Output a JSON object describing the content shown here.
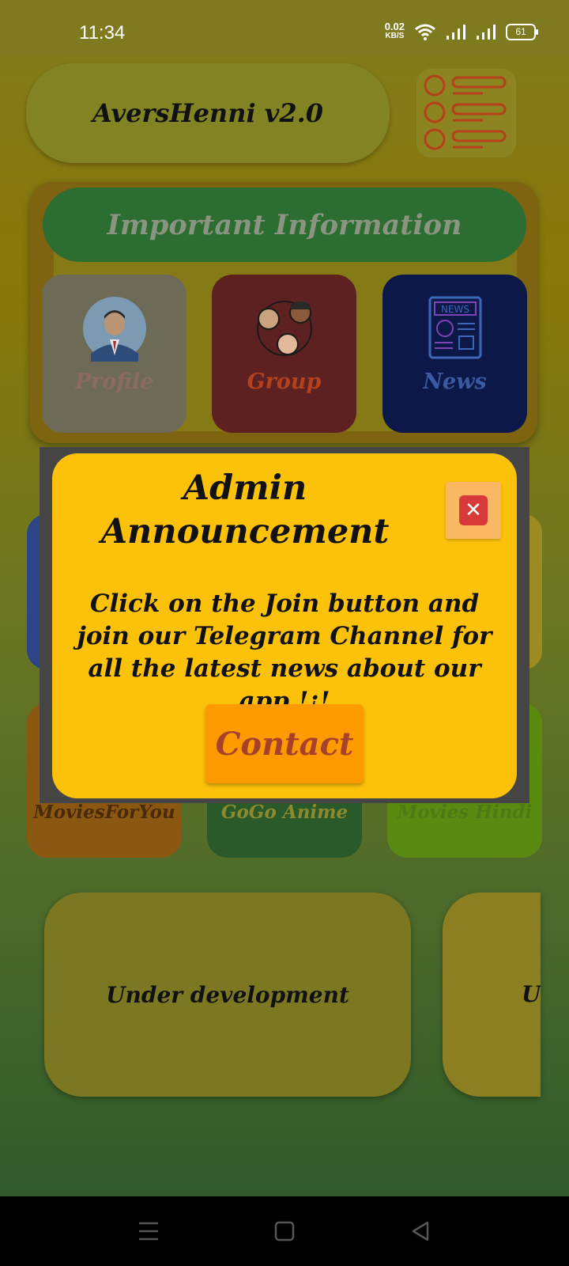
{
  "status_bar": {
    "time": "11:34",
    "net_speed_value": "0.02",
    "net_speed_unit": "KB/S",
    "battery": "61",
    "icons": [
      "wifi-icon",
      "signal-icon",
      "signal-icon",
      "battery-icon"
    ]
  },
  "header": {
    "title": "AversHenni v2.0",
    "menu_icon": "list-icon"
  },
  "info_panel": {
    "title": "Important Information",
    "tiles": [
      {
        "label": "Profile",
        "icon": "profile-avatar-icon",
        "color": "#6e6a58",
        "label_color": "#8c6b66"
      },
      {
        "label": "Group",
        "icon": "group-people-icon",
        "color": "#5c2120",
        "label_color": "#b2421e"
      },
      {
        "label": "News",
        "icon": "newspaper-icon",
        "color": "#0c1848",
        "label_color": "#3b5aa4"
      }
    ]
  },
  "cards": [
    {
      "label": "MoviesForYou",
      "label_color": "#4a2a0a"
    },
    {
      "label": "GoGo Anime",
      "label_color": "#8c8a2c"
    },
    {
      "label": "Movies Hindi",
      "label_color": "#4e7a14"
    }
  ],
  "dev_cards": [
    {
      "label": "Under development"
    },
    {
      "label": "Under development"
    }
  ],
  "dialog": {
    "title_line1": "Admin",
    "title_line2": "Announcement",
    "close_icon": "close-icon",
    "message": "Click on the Join button and join our Telegram Channel for all the latest news about our app !¡!",
    "button_label": "Contact",
    "accent": "#fcc20a",
    "button_color": "#fd9a00"
  },
  "nav_bar": {
    "buttons": [
      "menu-icon",
      "home-icon",
      "back-icon"
    ]
  }
}
